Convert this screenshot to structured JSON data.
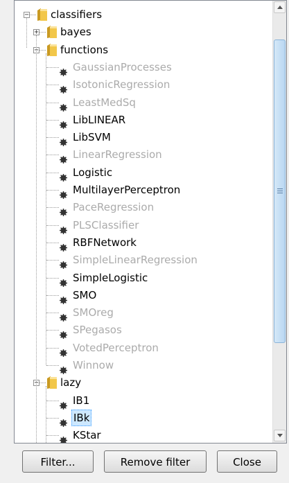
{
  "tree": {
    "root": {
      "label": "classifiers",
      "expander": "−"
    },
    "bayes": {
      "label": "bayes",
      "expander": "+"
    },
    "functions": {
      "label": "functions",
      "expander": "−"
    },
    "function_items": [
      {
        "label": "GaussianProcesses",
        "enabled": false
      },
      {
        "label": "IsotonicRegression",
        "enabled": false
      },
      {
        "label": "LeastMedSq",
        "enabled": false
      },
      {
        "label": "LibLINEAR",
        "enabled": true
      },
      {
        "label": "LibSVM",
        "enabled": true
      },
      {
        "label": "LinearRegression",
        "enabled": false
      },
      {
        "label": "Logistic",
        "enabled": true
      },
      {
        "label": "MultilayerPerceptron",
        "enabled": true
      },
      {
        "label": "PaceRegression",
        "enabled": false
      },
      {
        "label": "PLSClassifier",
        "enabled": false
      },
      {
        "label": "RBFNetwork",
        "enabled": true
      },
      {
        "label": "SimpleLinearRegression",
        "enabled": false
      },
      {
        "label": "SimpleLogistic",
        "enabled": true
      },
      {
        "label": "SMO",
        "enabled": true
      },
      {
        "label": "SMOreg",
        "enabled": false
      },
      {
        "label": "SPegasos",
        "enabled": false
      },
      {
        "label": "VotedPerceptron",
        "enabled": false
      },
      {
        "label": "Winnow",
        "enabled": false
      }
    ],
    "lazy": {
      "label": "lazy",
      "expander": "−"
    },
    "lazy_items": [
      {
        "label": "IB1",
        "enabled": true,
        "selected": false
      },
      {
        "label": "IBk",
        "enabled": true,
        "selected": true
      },
      {
        "label": "KStar",
        "enabled": true,
        "selected": false
      }
    ]
  },
  "buttons": {
    "filter": "Filter...",
    "remove_filter": "Remove filter",
    "close": "Close"
  },
  "colors": {
    "disabled_text": "#ababab",
    "selection_bg": "#cde8ff",
    "folder": "#f2c74a"
  }
}
